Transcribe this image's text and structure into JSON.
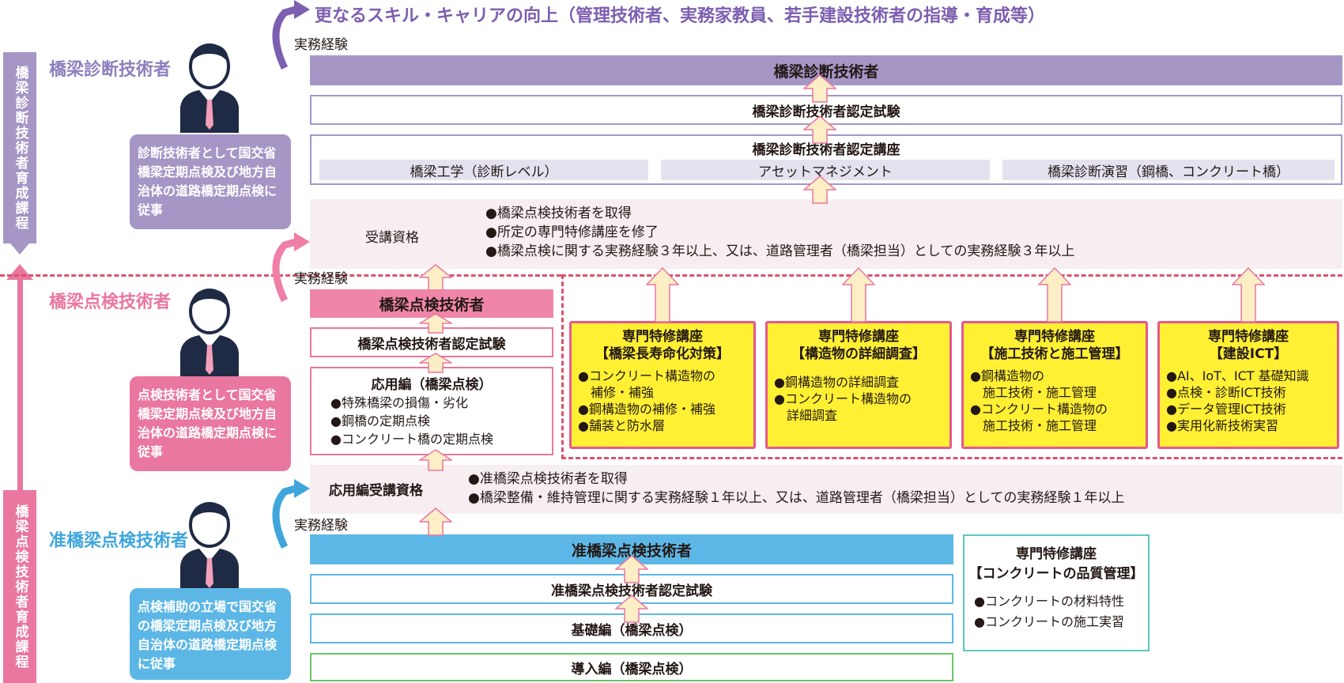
{
  "top_banner": "更なるスキル・キャリアの向上（管理技術者、実務家教員、若手建設技術者の指導・育成等）",
  "tracks": {
    "diagnosis": "橋梁診断技術者育成課程",
    "inspection": "橋梁点検技術者育成課程"
  },
  "roles": {
    "diagnosis": {
      "label": "橋梁診断技術者",
      "note": "診断技術者として国交省橋梁定期点検及び地方自治体の道路橋定期点検に従事"
    },
    "inspection": {
      "label": "橋梁点検技術者",
      "note": "点検技術者として国交省橋梁定期点検及び地方自治体の道路橋定期点検に従事"
    },
    "assistant": {
      "label": "准橋梁点検技術者",
      "note": "点検補助の立場で国交省の橋梁定期点検及び地方自治体の道路橋定期点検に従事"
    }
  },
  "experience_label": "実務経験",
  "diagnosis_path": {
    "title": "橋梁診断技術者",
    "exam": "橋梁診断技術者認定試験",
    "course": "橋梁診断技術者認定講座",
    "course_subjects": [
      "橋梁工学（診断レベル）",
      "アセットマネジメント",
      "橋梁診断演習（鋼橋、コンクリート橋）"
    ],
    "qualification_label": "受講資格",
    "qualification_items": [
      "●橋梁点検技術者を取得",
      "●所定の専門特修講座を修了",
      "●橋梁点検に関する実務経験３年以上、又は、道路管理者（橋梁担当）としての実務経験３年以上"
    ]
  },
  "inspection_path": {
    "title": "橋梁点検技術者",
    "exam": "橋梁点検技術者認定試験",
    "applied_title": "応用編（橋梁点検）",
    "applied_items": [
      "●特殊橋梁の損傷・劣化",
      "●鋼橋の定期点検",
      "●コンクリート橋の定期点検"
    ]
  },
  "special_courses": [
    {
      "title": "専門特修講座",
      "subtitle": "【橋梁長寿命化対策】",
      "items": [
        "●コンクリート構造物の",
        "　補修・補強",
        "●鋼構造物の補修・補強",
        "●舗装と防水層"
      ]
    },
    {
      "title": "専門特修講座",
      "subtitle": "【構造物の詳細調査】",
      "items": [
        "●鋼構造物の詳細調査",
        "●コンクリート構造物の",
        "　詳細調査"
      ]
    },
    {
      "title": "専門特修講座",
      "subtitle": "【施工技術と施工管理】",
      "items": [
        "●鋼構造物の",
        "　施工技術・施工管理",
        "●コンクリート構造物の",
        "　施工技術・施工管理"
      ]
    },
    {
      "title": "専門特修講座",
      "subtitle": "【建設ICT】",
      "items": [
        "●AI、IoT、ICT 基礎知識",
        "●点検・診断ICT技術",
        "●データ管理ICT技術",
        "●実用化新技術実習"
      ]
    }
  ],
  "applied_qualification": {
    "label": "応用編受講資格",
    "items": [
      "●准橋梁点検技術者を取得",
      "●橋梁整備・維持管理に関する実務経験１年以上、又は、道路管理者（橋梁担当）としての実務経験１年以上"
    ]
  },
  "assistant_path": {
    "title": "准橋梁点検技術者",
    "exam": "准橋梁点検技術者認定試験",
    "basic": "基礎編（橋梁点検）",
    "intro": "導入編（橋梁点検）"
  },
  "concrete_course": {
    "title": "専門特修講座",
    "subtitle": "【コンクリートの品質管理】",
    "items": [
      "●コンクリートの材料特性",
      "●コンクリートの施工実習"
    ]
  },
  "colors": {
    "purple": "#a596c6",
    "pink": "#e9779f",
    "blue": "#5db7e6",
    "yellow": "#fff033",
    "arrow_fill": "#fdeec6",
    "arrow_stroke": "#e9779f"
  }
}
